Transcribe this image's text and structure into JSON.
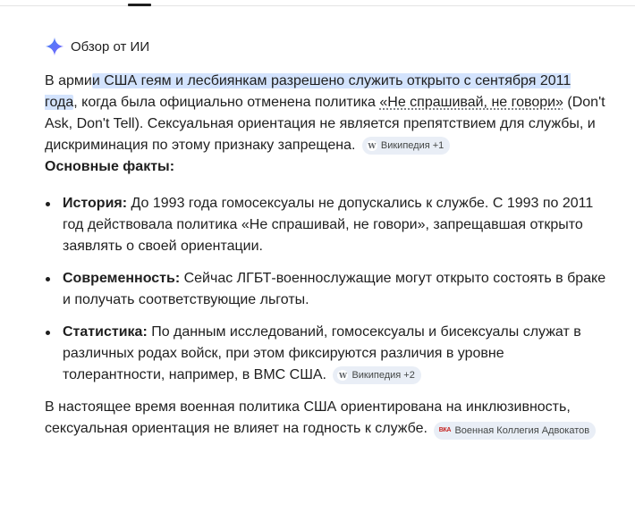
{
  "overview": {
    "title": "Обзор от ИИ"
  },
  "intro": {
    "prefix": "В арми",
    "highlight": "и США геям и лесбиянкам разрешено служить открыто с сентября 2011 года",
    "middle": ", когда была официально отменена политика ",
    "policy_link": "«Не спрашивай, не говори»",
    "suffix": " (Don't Ask, Don't Tell). Сексуальная ориентация не является препятствием для службы, и дискриминация по этому признаку запрещена.",
    "source": {
      "icon": "W",
      "label": "Википедия +1"
    }
  },
  "section_title": "Основные факты:",
  "facts": [
    {
      "label": "История:",
      "text": " До 1993 года гомосексуалы не допускались к службе. С 1993 по 2011 год действовала политика «Не спрашивай, не говори», запрещавшая открыто заявлять о своей ориентации."
    },
    {
      "label": "Современность:",
      "text": " Сейчас ЛГБТ-военнослужащие могут открыто состоять в браке и получать соответствующие льготы."
    },
    {
      "label": "Статистика:",
      "text": " По данным исследований, гомосексуалы и бисексуалы служат в различных родах войск, при этом фиксируются различия в уровне толерантности, например, в ВМС США.",
      "source": {
        "icon": "W",
        "label": "Википедия +2"
      }
    }
  ],
  "closing": {
    "text": "В настоящее время военная политика США ориентирована на инклюзивность, сексуальная ориентация не влияет на годность к службе.",
    "source": {
      "icon": "ВКА",
      "label": "Военная Коллегия Адвокатов"
    }
  },
  "colors": {
    "highlight": "#d3e3fd",
    "chip_bg": "#e9eef6",
    "spark_top": "#4285f4",
    "spark_bottom": "#7b61ff"
  },
  "icons": {
    "header": "gemini-spark-icon",
    "source_wiki": "wikipedia-icon",
    "source_vka": "vka-logo-icon"
  }
}
